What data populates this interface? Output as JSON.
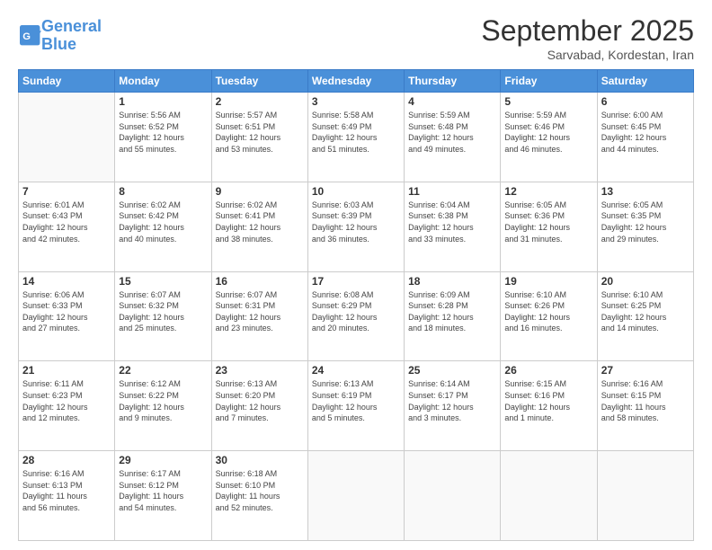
{
  "logo": {
    "line1": "General",
    "line2": "Blue"
  },
  "header": {
    "month": "September 2025",
    "location": "Sarvabad, Kordestan, Iran"
  },
  "weekdays": [
    "Sunday",
    "Monday",
    "Tuesday",
    "Wednesday",
    "Thursday",
    "Friday",
    "Saturday"
  ],
  "weeks": [
    [
      {
        "day": "",
        "info": ""
      },
      {
        "day": "1",
        "info": "Sunrise: 5:56 AM\nSunset: 6:52 PM\nDaylight: 12 hours\nand 55 minutes."
      },
      {
        "day": "2",
        "info": "Sunrise: 5:57 AM\nSunset: 6:51 PM\nDaylight: 12 hours\nand 53 minutes."
      },
      {
        "day": "3",
        "info": "Sunrise: 5:58 AM\nSunset: 6:49 PM\nDaylight: 12 hours\nand 51 minutes."
      },
      {
        "day": "4",
        "info": "Sunrise: 5:59 AM\nSunset: 6:48 PM\nDaylight: 12 hours\nand 49 minutes."
      },
      {
        "day": "5",
        "info": "Sunrise: 5:59 AM\nSunset: 6:46 PM\nDaylight: 12 hours\nand 46 minutes."
      },
      {
        "day": "6",
        "info": "Sunrise: 6:00 AM\nSunset: 6:45 PM\nDaylight: 12 hours\nand 44 minutes."
      }
    ],
    [
      {
        "day": "7",
        "info": "Sunrise: 6:01 AM\nSunset: 6:43 PM\nDaylight: 12 hours\nand 42 minutes."
      },
      {
        "day": "8",
        "info": "Sunrise: 6:02 AM\nSunset: 6:42 PM\nDaylight: 12 hours\nand 40 minutes."
      },
      {
        "day": "9",
        "info": "Sunrise: 6:02 AM\nSunset: 6:41 PM\nDaylight: 12 hours\nand 38 minutes."
      },
      {
        "day": "10",
        "info": "Sunrise: 6:03 AM\nSunset: 6:39 PM\nDaylight: 12 hours\nand 36 minutes."
      },
      {
        "day": "11",
        "info": "Sunrise: 6:04 AM\nSunset: 6:38 PM\nDaylight: 12 hours\nand 33 minutes."
      },
      {
        "day": "12",
        "info": "Sunrise: 6:05 AM\nSunset: 6:36 PM\nDaylight: 12 hours\nand 31 minutes."
      },
      {
        "day": "13",
        "info": "Sunrise: 6:05 AM\nSunset: 6:35 PM\nDaylight: 12 hours\nand 29 minutes."
      }
    ],
    [
      {
        "day": "14",
        "info": "Sunrise: 6:06 AM\nSunset: 6:33 PM\nDaylight: 12 hours\nand 27 minutes."
      },
      {
        "day": "15",
        "info": "Sunrise: 6:07 AM\nSunset: 6:32 PM\nDaylight: 12 hours\nand 25 minutes."
      },
      {
        "day": "16",
        "info": "Sunrise: 6:07 AM\nSunset: 6:31 PM\nDaylight: 12 hours\nand 23 minutes."
      },
      {
        "day": "17",
        "info": "Sunrise: 6:08 AM\nSunset: 6:29 PM\nDaylight: 12 hours\nand 20 minutes."
      },
      {
        "day": "18",
        "info": "Sunrise: 6:09 AM\nSunset: 6:28 PM\nDaylight: 12 hours\nand 18 minutes."
      },
      {
        "day": "19",
        "info": "Sunrise: 6:10 AM\nSunset: 6:26 PM\nDaylight: 12 hours\nand 16 minutes."
      },
      {
        "day": "20",
        "info": "Sunrise: 6:10 AM\nSunset: 6:25 PM\nDaylight: 12 hours\nand 14 minutes."
      }
    ],
    [
      {
        "day": "21",
        "info": "Sunrise: 6:11 AM\nSunset: 6:23 PM\nDaylight: 12 hours\nand 12 minutes."
      },
      {
        "day": "22",
        "info": "Sunrise: 6:12 AM\nSunset: 6:22 PM\nDaylight: 12 hours\nand 9 minutes."
      },
      {
        "day": "23",
        "info": "Sunrise: 6:13 AM\nSunset: 6:20 PM\nDaylight: 12 hours\nand 7 minutes."
      },
      {
        "day": "24",
        "info": "Sunrise: 6:13 AM\nSunset: 6:19 PM\nDaylight: 12 hours\nand 5 minutes."
      },
      {
        "day": "25",
        "info": "Sunrise: 6:14 AM\nSunset: 6:17 PM\nDaylight: 12 hours\nand 3 minutes."
      },
      {
        "day": "26",
        "info": "Sunrise: 6:15 AM\nSunset: 6:16 PM\nDaylight: 12 hours\nand 1 minute."
      },
      {
        "day": "27",
        "info": "Sunrise: 6:16 AM\nSunset: 6:15 PM\nDaylight: 11 hours\nand 58 minutes."
      }
    ],
    [
      {
        "day": "28",
        "info": "Sunrise: 6:16 AM\nSunset: 6:13 PM\nDaylight: 11 hours\nand 56 minutes."
      },
      {
        "day": "29",
        "info": "Sunrise: 6:17 AM\nSunset: 6:12 PM\nDaylight: 11 hours\nand 54 minutes."
      },
      {
        "day": "30",
        "info": "Sunrise: 6:18 AM\nSunset: 6:10 PM\nDaylight: 11 hours\nand 52 minutes."
      },
      {
        "day": "",
        "info": ""
      },
      {
        "day": "",
        "info": ""
      },
      {
        "day": "",
        "info": ""
      },
      {
        "day": "",
        "info": ""
      }
    ]
  ]
}
